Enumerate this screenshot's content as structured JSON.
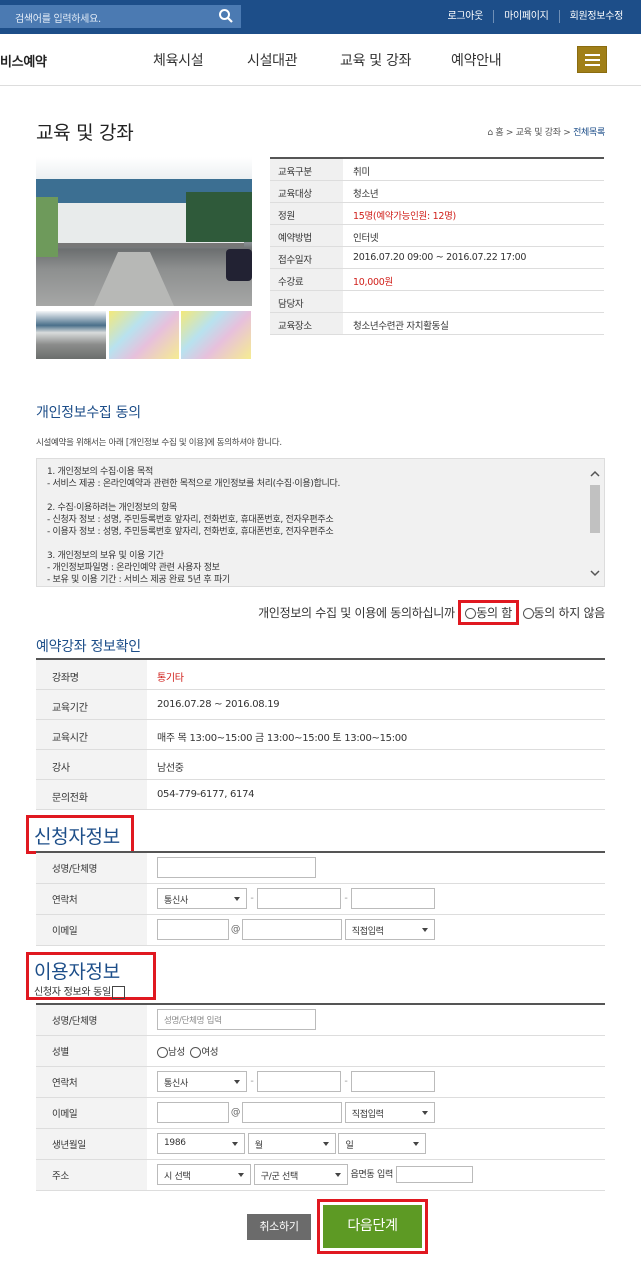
{
  "header": {
    "search_placeholder": "검색어를 입력하세요.",
    "links": [
      "로그아웃",
      "마이페이지",
      "회원정보수정"
    ],
    "brand": "비스예약",
    "nav": [
      "체육시설",
      "시설대관",
      "교육 및 강좌",
      "예약안내"
    ]
  },
  "page": {
    "title": "교육 및 강좌",
    "breadcrumb": [
      "홈",
      "교육 및 강좌",
      "전체목록"
    ]
  },
  "course_info": [
    {
      "k": "교육구분",
      "v": "취미"
    },
    {
      "k": "교육대상",
      "v": "청소년"
    },
    {
      "k": "정원",
      "v": "15명(예약가능인원: 12명)",
      "red": true
    },
    {
      "k": "예약방법",
      "v": "인터넷"
    },
    {
      "k": "접수일자",
      "v": "2016.07.20 09:00 ~ 2016.07.22 17:00"
    },
    {
      "k": "수강료",
      "v": "10,000원",
      "red": true
    },
    {
      "k": "담당자",
      "v": ""
    },
    {
      "k": "교육장소",
      "v": "청소년수련관 자치활동실"
    }
  ],
  "privacy": {
    "title": "개인정보수집 동의",
    "intro": "시설예약을 위해서는 아래 [개인정보 수집 및 이용]에 동의하셔야 합니다.",
    "lines": [
      "1. 개인정보의 수집·이용 목적",
      "- 서비스 제공 : 온라인예약과 관련한 목적으로 개인정보를 처리(수집·이용)합니다.",
      "",
      "2. 수집·이용하려는 개인정보의 항목",
      "- 신청자 정보 : 성명, 주민등록번호 앞자리, 전화번호, 휴대폰번호, 전자우편주소",
      "- 이용자 정보 : 성명, 주민등록번호 앞자리, 전화번호, 휴대폰번호, 전자우편주소",
      "",
      "3. 개인정보의 보유 및 이용 기간",
      "- 개인정보파일명 : 온라인예약 관련 사용자 정보",
      "- 보유 및 이용 기간 : 서비스 제공 완료 5년 후 파기"
    ],
    "question": "개인정보의 수집 및 이용에 동의하십니까",
    "agree": "동의 함",
    "disagree": "동의 하지 않음"
  },
  "lecture": {
    "title": "예약강좌 정보확인",
    "rows": [
      {
        "k": "강좌명",
        "v": "통기타",
        "red": true
      },
      {
        "k": "교육기간",
        "v": "2016.07.28 ~ 2016.08.19"
      },
      {
        "k": "교육시간",
        "v": "매주 목 13:00~15:00 금 13:00~15:00 토 13:00~15:00"
      },
      {
        "k": "강사",
        "v": "남선중"
      },
      {
        "k": "문의전화",
        "v": "054-779-6177, 6174"
      }
    ]
  },
  "applicant": {
    "title": "신청자정보",
    "labels": [
      "성명/단체명",
      "연락처",
      "이메일"
    ],
    "carrier": "통신사",
    "domain": "직접입력"
  },
  "user": {
    "title": "이용자정보",
    "same_label": "신청자 정보와 동일",
    "labels": [
      "성명/단체명",
      "성별",
      "연락처",
      "이메일",
      "생년월일",
      "주소"
    ],
    "name_placeholder": "성명/단체명 입력",
    "male": "남성",
    "female": "여성",
    "carrier": "통신사",
    "domain": "직접입력",
    "year": "1986",
    "month": "월",
    "day": "일",
    "city": "시 선택",
    "district": "구/군 선택",
    "town_label": "읍면동 입력"
  },
  "buttons": {
    "cancel": "취소하기",
    "next": "다음단계"
  }
}
